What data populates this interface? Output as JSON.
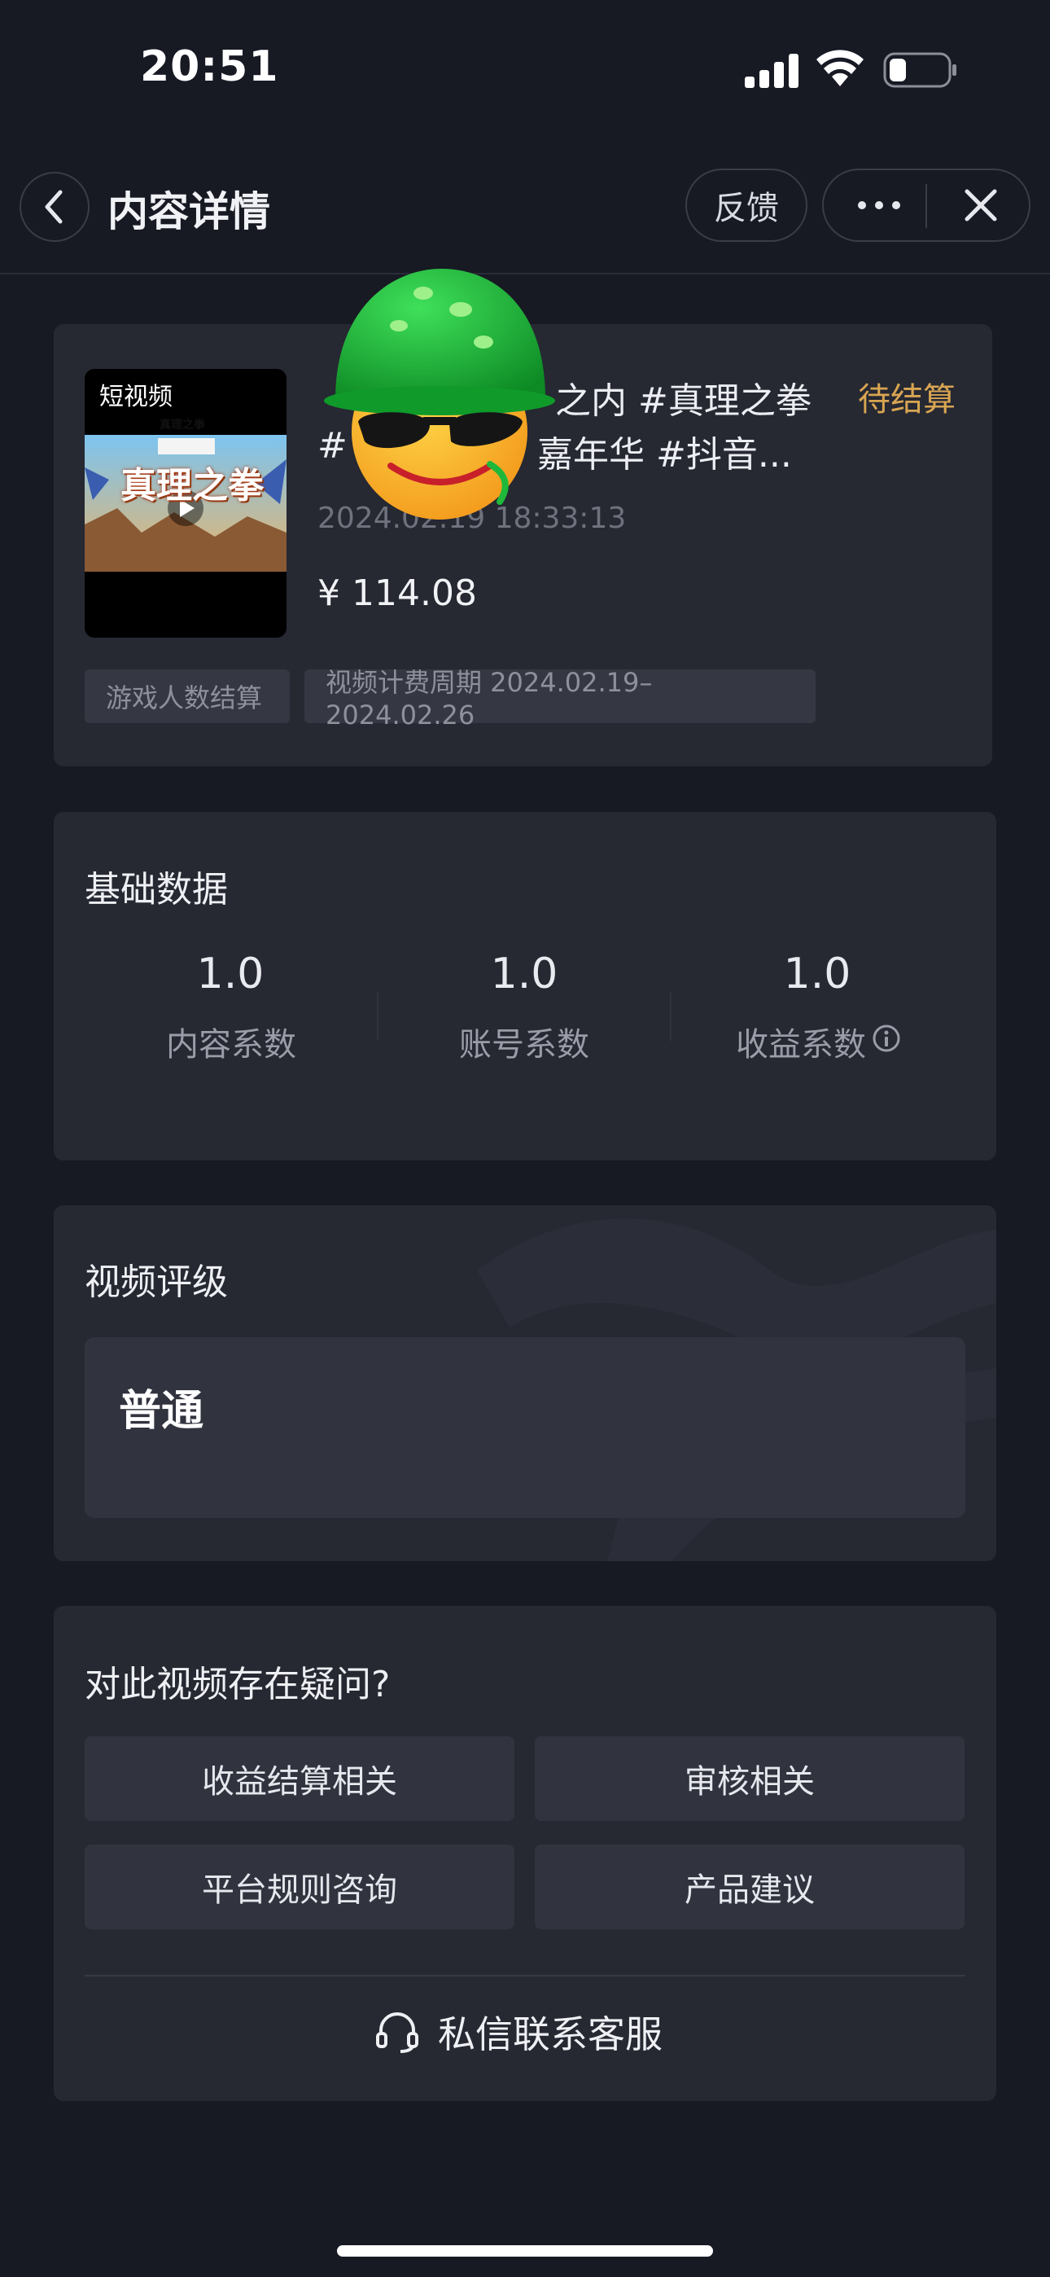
{
  "status_bar": {
    "time": "20:51"
  },
  "nav": {
    "title": "内容详情",
    "feedback_label": "反馈"
  },
  "content": {
    "thumb_tag": "短视频",
    "thumb_game_title": "真理之拳",
    "thumb_game_title_large": "真理之拳",
    "title_line1": "之内 #真理之拳",
    "title_line2_prefix": "#",
    "title_line2_suffix": "嘉年华 #抖音...",
    "status": "待结算",
    "date": "2024.02.19 18:33:13",
    "amount": "¥ 114.08",
    "tags": [
      "游戏人数结算",
      "视频计费周期 2024.02.19–2024.02.26"
    ]
  },
  "basic": {
    "title": "基础数据",
    "metrics": [
      {
        "value": "1.0",
        "label": "内容系数"
      },
      {
        "value": "1.0",
        "label": "账号系数"
      },
      {
        "value": "1.0",
        "label": "收益系数"
      }
    ]
  },
  "rating": {
    "title": "视频评级",
    "value": "普通"
  },
  "question": {
    "title": "对此视频存在疑问?",
    "buttons": [
      "收益结算相关",
      "审核相关",
      "平台规则咨询",
      "产品建议"
    ],
    "contact_label": "私信联系客服"
  },
  "colors": {
    "background": "#171923",
    "card": "#262832",
    "pending": "#d8a552"
  },
  "icons": [
    "chevron-left-icon",
    "more-icon",
    "close-icon",
    "info-icon",
    "headset-icon",
    "play-icon",
    "sticker-emoji-icon"
  ]
}
